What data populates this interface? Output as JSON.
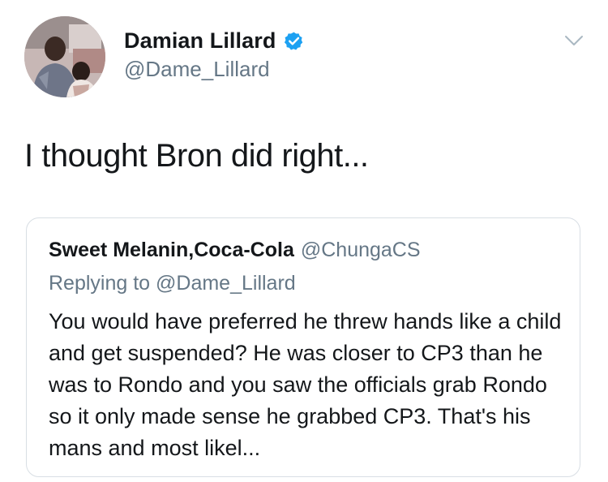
{
  "author": {
    "display_name": "Damian Lillard",
    "handle": "@Dame_Lillard",
    "verified": true,
    "avatar_icon": "profile-photo"
  },
  "menu": {
    "icon": "chevron-down-icon"
  },
  "tweet": {
    "text": "I thought Bron did right..."
  },
  "quoted_tweet": {
    "display_name": "Sweet Melanin,Coca-Cola",
    "handle": "@ChungaCS",
    "replying_to": "Replying to @Dame_Lillard",
    "text": "You would have preferred he threw hands like a child and get suspended? He was closer to CP3 than he was to Rondo and you saw the officials grab Rondo so it only made sense he grabbed CP3. That's his mans and most likel..."
  },
  "colors": {
    "primary_text": "#14171a",
    "secondary_text": "#657786",
    "verified_blue": "#1da1f2",
    "card_border": "#d8dee4"
  }
}
